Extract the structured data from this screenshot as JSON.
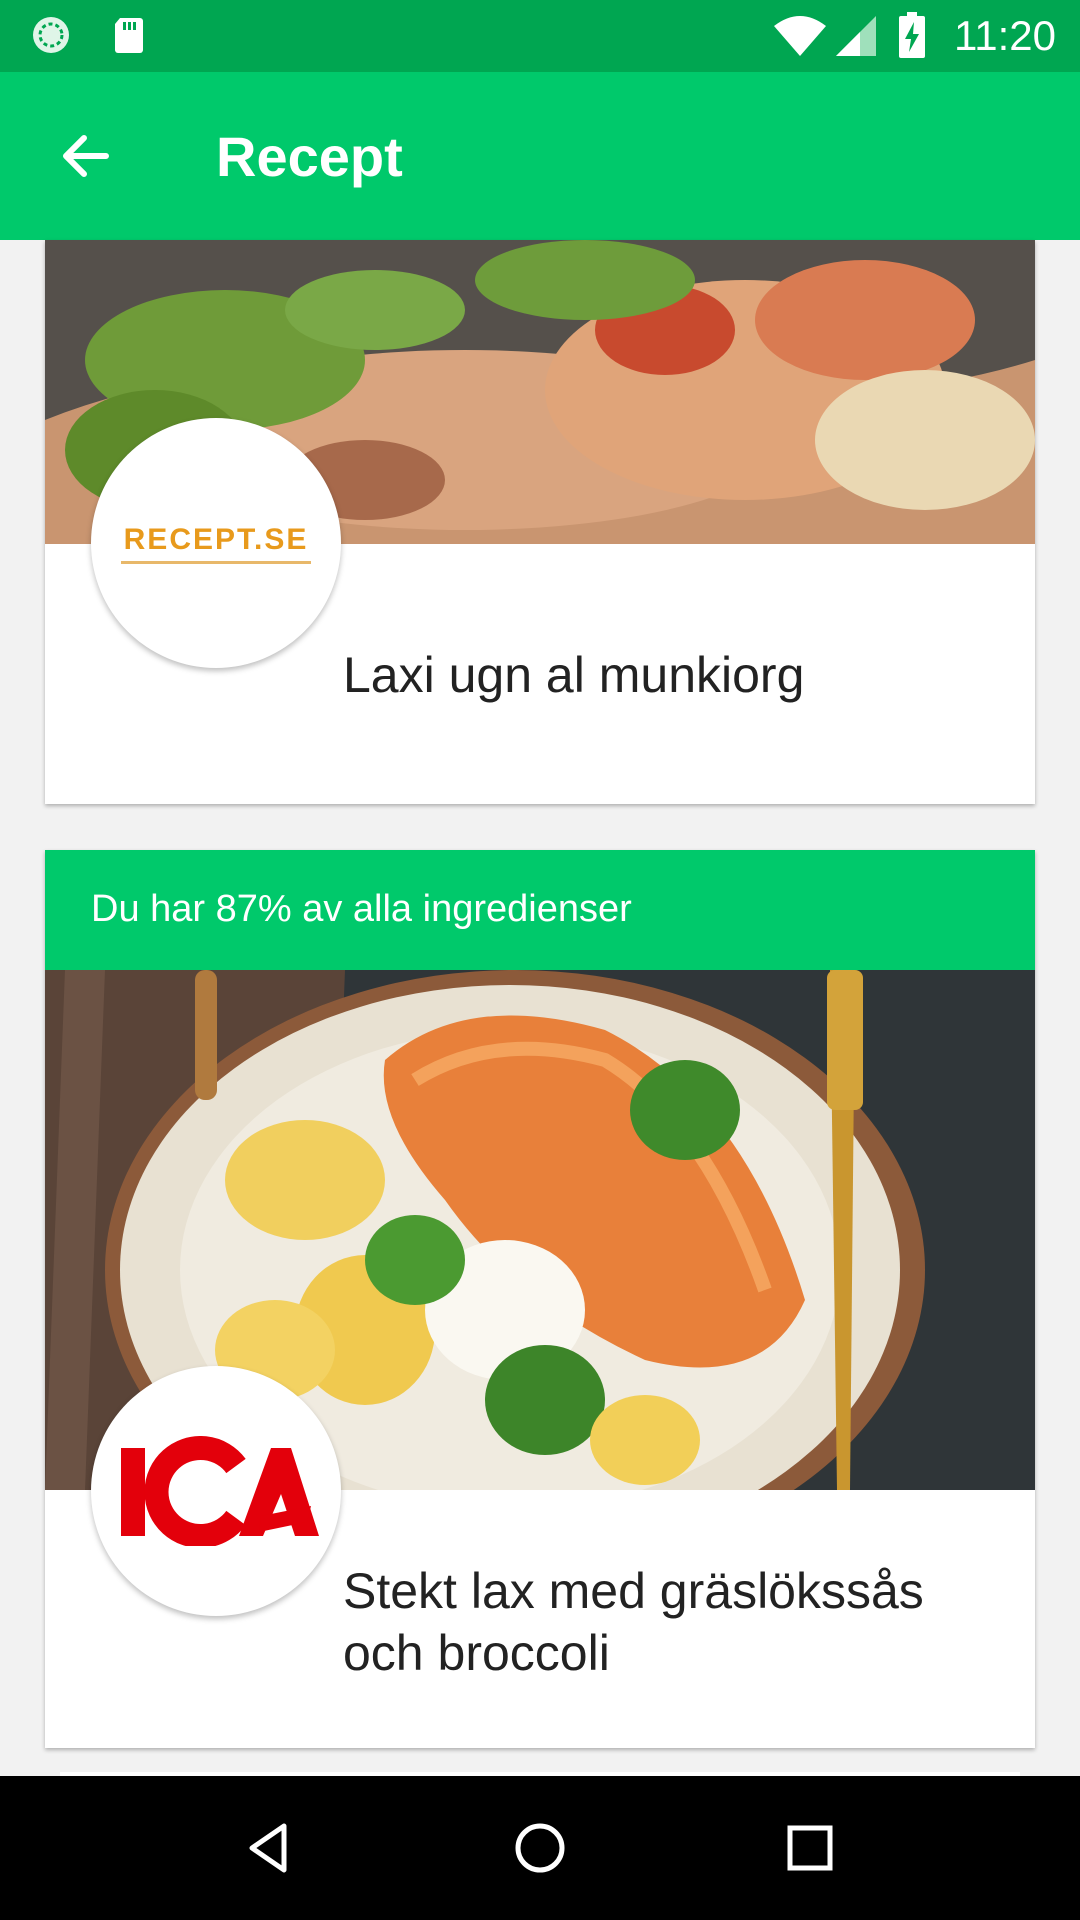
{
  "status_bar": {
    "time": "11:20",
    "icons": [
      "sync-icon",
      "sd-card-icon",
      "wifi-icon",
      "signal-icon",
      "battery-charging-icon"
    ]
  },
  "app_bar": {
    "title": "Recept",
    "back_icon": "arrow-left-icon"
  },
  "recipes": [
    {
      "source_logo": "RECEPT.SE",
      "title": "Laxi ugn al munkiorg"
    },
    {
      "banner": "Du har 87%  av alla ingredienser",
      "source_logo": "ICA",
      "title": "Stekt lax med gräslökssås och broccoli"
    }
  ],
  "nav_bar": {
    "icons": [
      "back-triangle-icon",
      "home-circle-icon",
      "recents-square-icon"
    ]
  },
  "colors": {
    "status_bar": "#00a651",
    "app_bar": "#00c96b",
    "ica_red": "#e3000b"
  }
}
